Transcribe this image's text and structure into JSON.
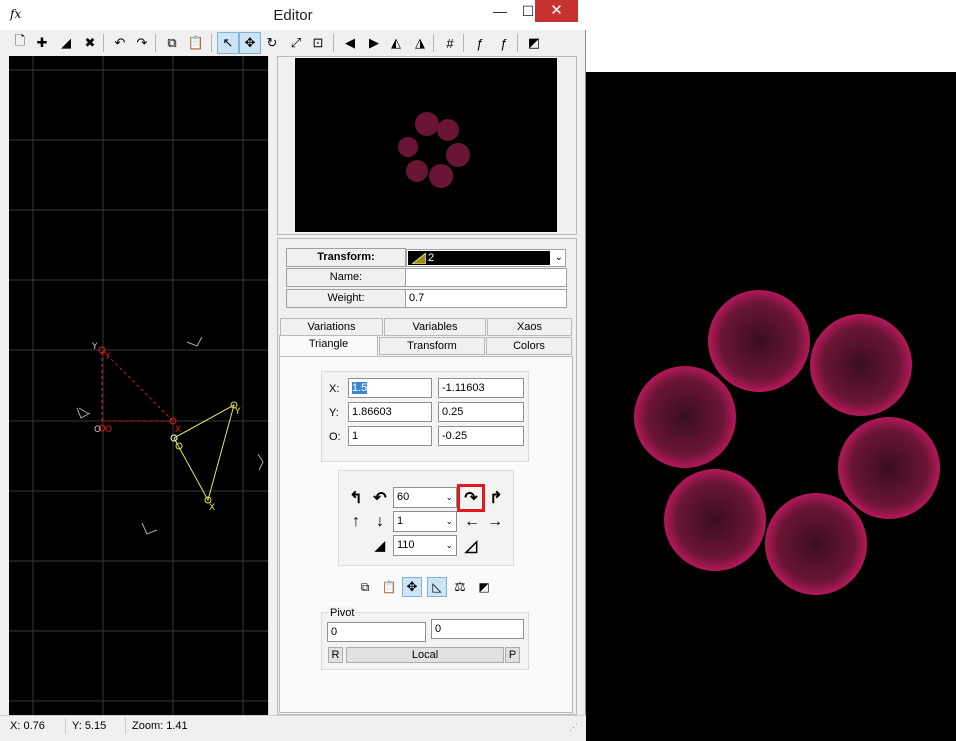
{
  "window": {
    "title": "Editor",
    "title_icon": "fx",
    "minimize": "—",
    "maximize": "☐",
    "close": "✕"
  },
  "toolbar": [
    {
      "name": "new-flame-icon",
      "glyph": "🗋"
    },
    {
      "name": "add-transform-icon",
      "glyph": "✚"
    },
    {
      "name": "duplicate-transform-icon",
      "glyph": "◢"
    },
    {
      "name": "delete-transform-icon",
      "glyph": "✖"
    },
    {
      "name": "undo-icon",
      "glyph": "↶"
    },
    {
      "name": "redo-icon",
      "glyph": "↷"
    },
    {
      "name": "copy-icon",
      "glyph": "⧉"
    },
    {
      "name": "paste-icon",
      "glyph": "📋"
    },
    {
      "name": "select-mode-icon",
      "glyph": "↖",
      "active": true
    },
    {
      "name": "move-mode-icon",
      "glyph": "✥",
      "active": true
    },
    {
      "name": "rotate-mode-icon",
      "glyph": "↻"
    },
    {
      "name": "scale-mode-icon",
      "glyph": "⤢"
    },
    {
      "name": "autozoom-icon",
      "glyph": "⊡"
    },
    {
      "name": "flip-left-icon",
      "glyph": "◀"
    },
    {
      "name": "flip-right-icon",
      "glyph": "▶"
    },
    {
      "name": "flip-horizontal-icon",
      "glyph": "◭"
    },
    {
      "name": "flip-vertical-icon",
      "glyph": "◮"
    },
    {
      "name": "grid-icon",
      "glyph": "#"
    },
    {
      "name": "final-transform-icon",
      "glyph": "ƒ"
    },
    {
      "name": "final-transform-enable-icon",
      "glyph": "ƒ"
    },
    {
      "name": "post-transform-icon",
      "glyph": "◩"
    }
  ],
  "transform": {
    "transform_label": "Transform:",
    "transform_value": "2",
    "name_label": "Name:",
    "name_value": "",
    "weight_label": "Weight:",
    "weight_value": "0.7"
  },
  "tabs_row1": [
    "Variations",
    "Variables",
    "Xaos"
  ],
  "tabs_row2": [
    "Triangle",
    "Transform",
    "Colors"
  ],
  "selected_tab": "Triangle",
  "coords": {
    "x_label": "X:",
    "x1": "1.5",
    "x2": "-1.11603",
    "y_label": "Y:",
    "y1": "1.86603",
    "y2": "0.25",
    "o_label": "O:",
    "o1": "1",
    "o2": "-0.25"
  },
  "controls": {
    "rotate_value": "60",
    "move_value": "1",
    "scale_value": "110"
  },
  "pivot": {
    "label": "Pivot",
    "x": "0",
    "y": "0",
    "reset": "R",
    "mode": "Local",
    "pick": "P"
  },
  "status": {
    "x": "X: 0.76",
    "y": "Y: 5.15",
    "zoom": "Zoom: 1.41"
  },
  "colors": {
    "highlight": "#e0191e",
    "flame": "#b3124f",
    "transform1": "#e01818",
    "transform2": "#e5e05a"
  }
}
